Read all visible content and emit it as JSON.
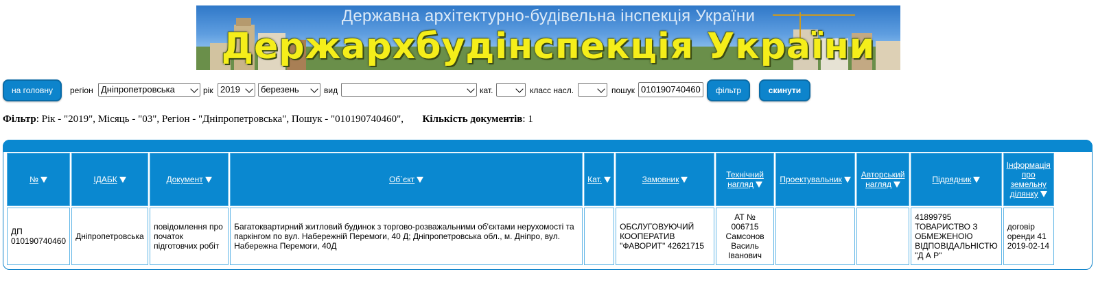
{
  "banner": {
    "subtitle": "Державна архітектурно-будівельна інспекція України",
    "title": "Держархбудінспекція України"
  },
  "toolbar": {
    "home_label": "на головну",
    "region_label": "регіон",
    "region_value": "Дніпропетровська",
    "year_label": "рік",
    "year_value": "2019",
    "month_value": "березень",
    "type_label": "вид",
    "type_value": "",
    "category_label": "кат.",
    "category_value": "",
    "class_label": "класс насл.",
    "class_value": "",
    "search_label": "пошук",
    "search_value": "010190740460",
    "filter_label": "фільтр",
    "reset_label": "скинути"
  },
  "filter": {
    "label": "Фільтр",
    "text": ": Рік - \"2019\", Місяць - \"03\", Регіон - \"Дніпропетровська\", Пошук - \"010190740460\",",
    "count_label": "Кількість документів",
    "count_value": ": 1"
  },
  "table": {
    "headers": [
      "№",
      "ІДАБК",
      "Документ",
      "Об`єкт",
      "Кат.",
      "Замовник",
      "Технічний нагляд",
      "Проектувальник",
      "Авторський нагляд",
      "Підрядник",
      "Інформація про земельну ділянку"
    ],
    "row": {
      "num": "ДП 010190740460",
      "idabk": "Дніпропетровська",
      "document": "повідомлення про початок підготовчих робіт",
      "object": "Багатоквартирний житловий будинок з торгово-розважальними об'єктами нерухомості та паркінгом по вул. Набережній Перемоги, 40 Д; Дніпропетровська обл., м. Дніпро, вул. Набережна Перемоги, 40Д",
      "category": "",
      "customer": "ОБСЛУГОВУЮЧИЙ КООПЕРАТИВ \"ФАВОРИТ\" 42621715",
      "tech_supervision": "АТ № 006715 Самсонов Василь Іванович",
      "designer": "",
      "author_supervision": "",
      "contractor": "41899795 ТОВАРИСТВО З ОБМЕЖЕНОЮ ВІДПОВІДАЛЬНІСТЮ \"Д А Р\"",
      "land_info": "договір оренди 41 2019-02-14"
    }
  }
}
